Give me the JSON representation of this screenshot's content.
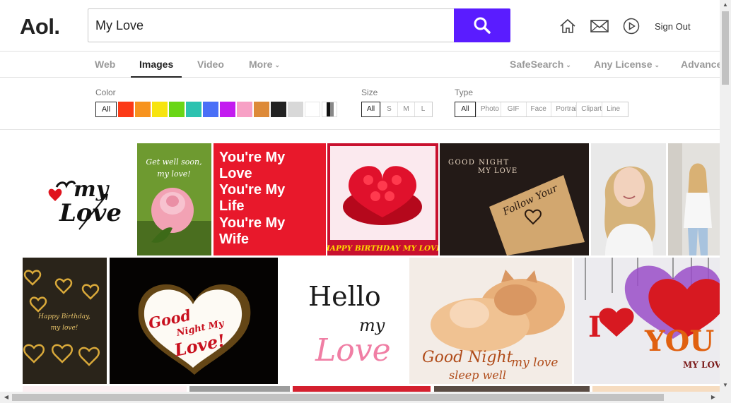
{
  "header": {
    "logo": "Aol.",
    "search_value": "My Love",
    "sign_out": "Sign Out",
    "icons": [
      "home-icon",
      "mail-icon",
      "video-play-icon",
      "search-icon"
    ]
  },
  "tabs": [
    {
      "label": "Web"
    },
    {
      "label": "Images",
      "active": true
    },
    {
      "label": "Video"
    },
    {
      "label": "More"
    },
    {
      "label": "SafeSearch"
    },
    {
      "label": "Any License"
    },
    {
      "label": "Advance"
    }
  ],
  "filters": {
    "color_label": "Color",
    "color_all": "All",
    "colors": [
      "#fc3a17",
      "#f7931e",
      "#f7e40e",
      "#6ad616",
      "#2cc2b0",
      "#4a6ff7",
      "#c31bf0",
      "#f7a0c5",
      "#dd8a38",
      "#222222",
      "#d8d8d8",
      "#ffffff",
      "bw"
    ],
    "size_label": "Size",
    "sizes": [
      "All",
      "S",
      "M",
      "L"
    ],
    "type_label": "Type",
    "types": [
      "All",
      "Photo",
      "GIF",
      "Face",
      "Portrait",
      "Clipart",
      "Line"
    ]
  },
  "results": {
    "texts": {
      "getwell_line1": "Get well soon,",
      "getwell_line2": "my love!",
      "wife_l1": "You're My",
      "wife_l2": "Love",
      "wife_l3": "You're My",
      "wife_l4": "Life",
      "wife_l5": "You're My",
      "wife_l6": "Wife",
      "cake_caption": "HAPPY BIRTHDAY MY LOVE",
      "gn_line1": "GOOD NIGHT",
      "gn_line2": "MY LOVE",
      "gn_card": "Follow Your",
      "bday_line1": "Happy Birthday,",
      "bday_line2": "my love!",
      "heart_l1": "Good",
      "heart_l2": "Night My",
      "heart_l3": "Love!",
      "hello_l1": "Hello",
      "hello_l2": "my",
      "hello_l3": "Love",
      "cats_l1": "Good Night",
      "cats_l2": "my love",
      "cats_l3": "sleep well",
      "iloveyou_i": "I",
      "iloveyou_you": "YOU",
      "iloveyou_mylove": "MY LOVE",
      "mylove_l1": "my",
      "mylove_l2": "Love"
    }
  },
  "colors": {
    "accent": "#5a1cff",
    "tab_active": "#222222",
    "tab_inactive": "#999999"
  }
}
